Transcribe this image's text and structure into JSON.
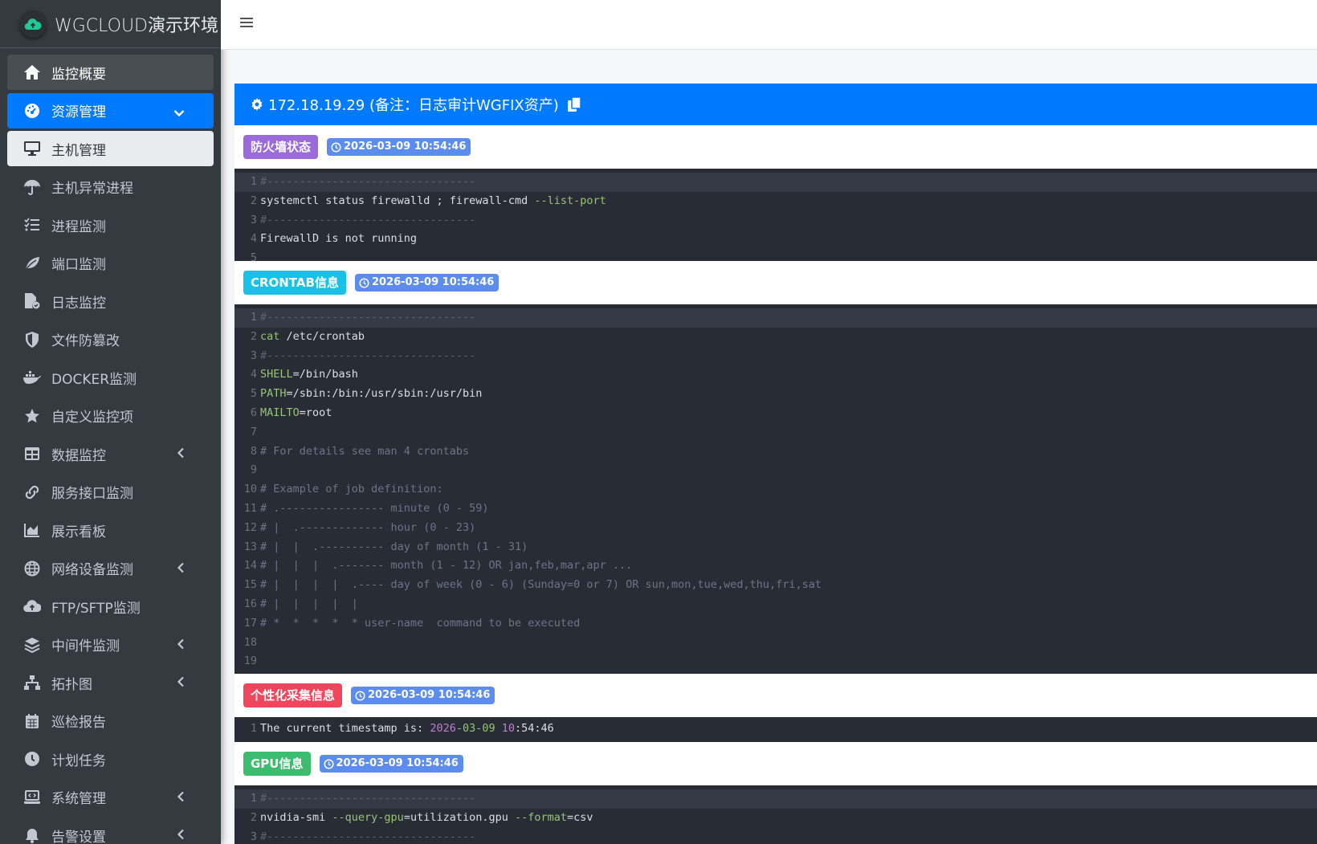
{
  "brand": {
    "title": "WGCLOUD演示环境"
  },
  "sidebar": {
    "items": [
      {
        "label": "监控概要",
        "icon": "home-icon",
        "state": "active-dark"
      },
      {
        "label": "资源管理",
        "icon": "dashboard-gauge-icon",
        "state": "active-blue",
        "chevron": "chevron-down-icon"
      },
      {
        "label": "主机管理",
        "icon": "desktop-icon",
        "state": "active-light"
      },
      {
        "label": "主机异常进程",
        "icon": "umbrella-icon"
      },
      {
        "label": "进程监测",
        "icon": "tasks-list-icon"
      },
      {
        "label": "端口监测",
        "icon": "leaf-icon"
      },
      {
        "label": "日志监控",
        "icon": "file-check-icon"
      },
      {
        "label": "文件防篡改",
        "icon": "shield-icon"
      },
      {
        "label": "DOCKER监测",
        "icon": "docker-icon"
      },
      {
        "label": "自定义监控项",
        "icon": "star-icon"
      },
      {
        "label": "数据监控",
        "icon": "table-icon",
        "chevron": "chevron-left-icon"
      },
      {
        "label": "服务接口监测",
        "icon": "link-icon"
      },
      {
        "label": "展示看板",
        "icon": "area-chart-icon"
      },
      {
        "label": "网络设备监测",
        "icon": "globe-icon",
        "chevron": "chevron-left-icon"
      },
      {
        "label": "FTP/SFTP监测",
        "icon": "cloud-upload-icon"
      },
      {
        "label": "中间件监测",
        "icon": "layers-icon",
        "chevron": "chevron-left-icon"
      },
      {
        "label": "拓扑图",
        "icon": "sitemap-icon",
        "chevron": "chevron-left-icon"
      },
      {
        "label": "巡检报告",
        "icon": "calendar-icon"
      },
      {
        "label": "计划任务",
        "icon": "clock-icon"
      },
      {
        "label": "系统管理",
        "icon": "laptop-code-icon",
        "chevron": "chevron-left-icon"
      },
      {
        "label": "告警设置",
        "icon": "bell-icon",
        "chevron": "chevron-left-icon"
      }
    ]
  },
  "header": {
    "title": "172.18.19.29 (备注：日志审计WGFIX资产)",
    "gear_icon": "gear-icon",
    "copy_icon": "copy-icon"
  },
  "sections": [
    {
      "title": "防火墙状态",
      "color": "#9b6bdb",
      "time": "2026-03-09 10:54:46"
    },
    {
      "title": "CRONTAB信息",
      "color": "#17c1e8",
      "time": "2026-03-09 10:54:46"
    },
    {
      "title": "个性化采集信息",
      "color": "#f0465d",
      "time": "2026-03-09 10:54:46"
    },
    {
      "title": "GPU信息",
      "color": "#3cbc6e",
      "time": "2026-03-09 10:54:46"
    }
  ],
  "code": {
    "firewall": [
      "#--------------------------------",
      "systemctl status firewalld ; firewall-cmd ",
      "--list-port",
      "#--------------------------------",
      "FirewallD is not running"
    ],
    "crontab": [
      "#--------------------------------",
      "cat",
      " /etc/crontab",
      "#--------------------------------",
      "SHELL",
      "=/bin/bash",
      "PATH",
      "=/sbin:/bin:/usr/sbin:/usr/bin",
      "MAILTO",
      "=root",
      "# For details see man 4 crontabs",
      "# Example of job definition:",
      "# .---------------- minute (0 - 59)",
      "# |  .------------- hour (0 - 23)",
      "# |  |  .---------- day of month (1 - 31)",
      "# |  |  |  .------- month (1 - 12) OR jan,feb,mar,apr ...",
      "# |  |  |  |  .---- day of week (0 - 6) (Sunday=0 or 7) OR sun,mon,tue,wed,thu,fri,sat",
      "# |  |  |  |  |",
      "# *  *  *  *  * user-name  command to be executed"
    ],
    "custom": [
      "The current timestamp is: ",
      "2026",
      "-03-09 ",
      "10",
      ":54:46"
    ],
    "gpu": [
      "#--------------------------------",
      "nvidia-smi ",
      "--query-gpu",
      "=utilization.gpu ",
      "--format",
      "=csv",
      "#--------------------------------"
    ]
  }
}
